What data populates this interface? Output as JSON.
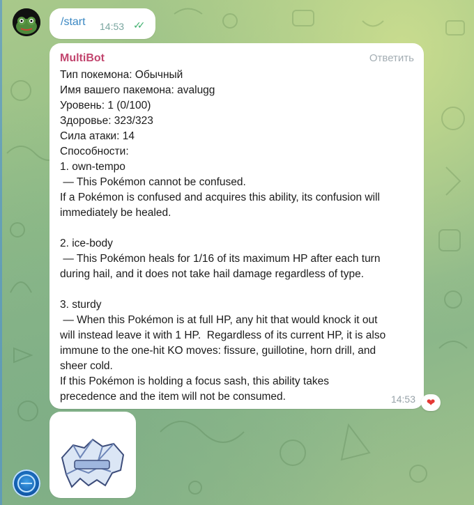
{
  "chat": {
    "outgoing": {
      "text": "/start",
      "time": "14:53",
      "status_icon": "double-check-icon"
    },
    "bot_message": {
      "sender": "MultiBot",
      "reply_label": "Ответить",
      "lines": [
        "Тип покемона: Обычный",
        "Имя вашего пакемона: avalugg",
        "Уровень: 1 (0/100)",
        "Здоровье: 323/323",
        "Сила атаки: 14",
        "Способности:",
        "1. own-tempo",
        " — This Pokémon cannot be confused.",
        "If a Pokémon is confused and acquires this ability, its confusion will",
        "immediately be healed.",
        "",
        "2. ice-body",
        " — This Pokémon heals for 1/16 of its maximum HP after each turn",
        "during hail, and it does not take hail damage regardless of type.",
        "",
        "3. sturdy",
        " — When this Pokémon is at full HP, any hit that would knock it out",
        "will instead leave it with 1 HP.  Regardless of its current HP, it is also",
        "immune to the one-hit KO moves: fissure, guillotine, horn drill, and",
        "sheer cold.",
        "If this Pokémon is holding a focus sash, this ability takes",
        "precedence and the item will not be consumed."
      ],
      "time": "14:53",
      "reaction": "heart-icon"
    },
    "image_message": {
      "sprite_icon": "avalugg-sprite-icon"
    }
  },
  "colors": {
    "sender": "#c2456e",
    "link": "#3b88c3",
    "check": "#3fb06e",
    "heart": "#e53935"
  }
}
